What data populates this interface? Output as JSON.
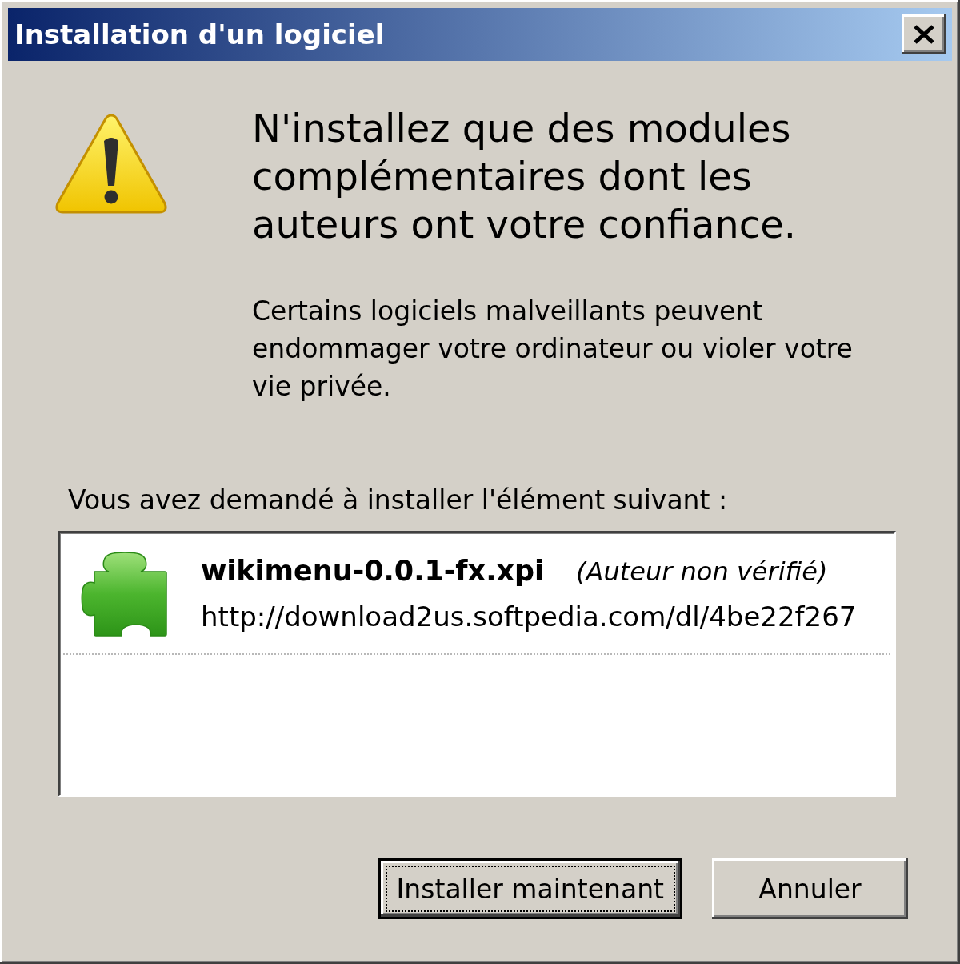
{
  "window": {
    "title": "Installation d'un logiciel"
  },
  "warning": {
    "heading": "N'installez que des modules complémentaires dont les auteurs ont votre confiance.",
    "message": "Certains logiciels malveillants peuvent endommager votre ordinateur ou violer votre vie privée."
  },
  "request_label": "Vous avez demandé à installer l'élément suivant :",
  "items": [
    {
      "name": "wikimenu-0.0.1-fx.xpi",
      "author_status": "(Auteur non vérifié)",
      "url": "http://download2us.softpedia.com/dl/4be22f267"
    }
  ],
  "buttons": [
    {
      "label": "Installer maintenant",
      "default": true
    },
    {
      "label": "Annuler",
      "default": false
    }
  ]
}
